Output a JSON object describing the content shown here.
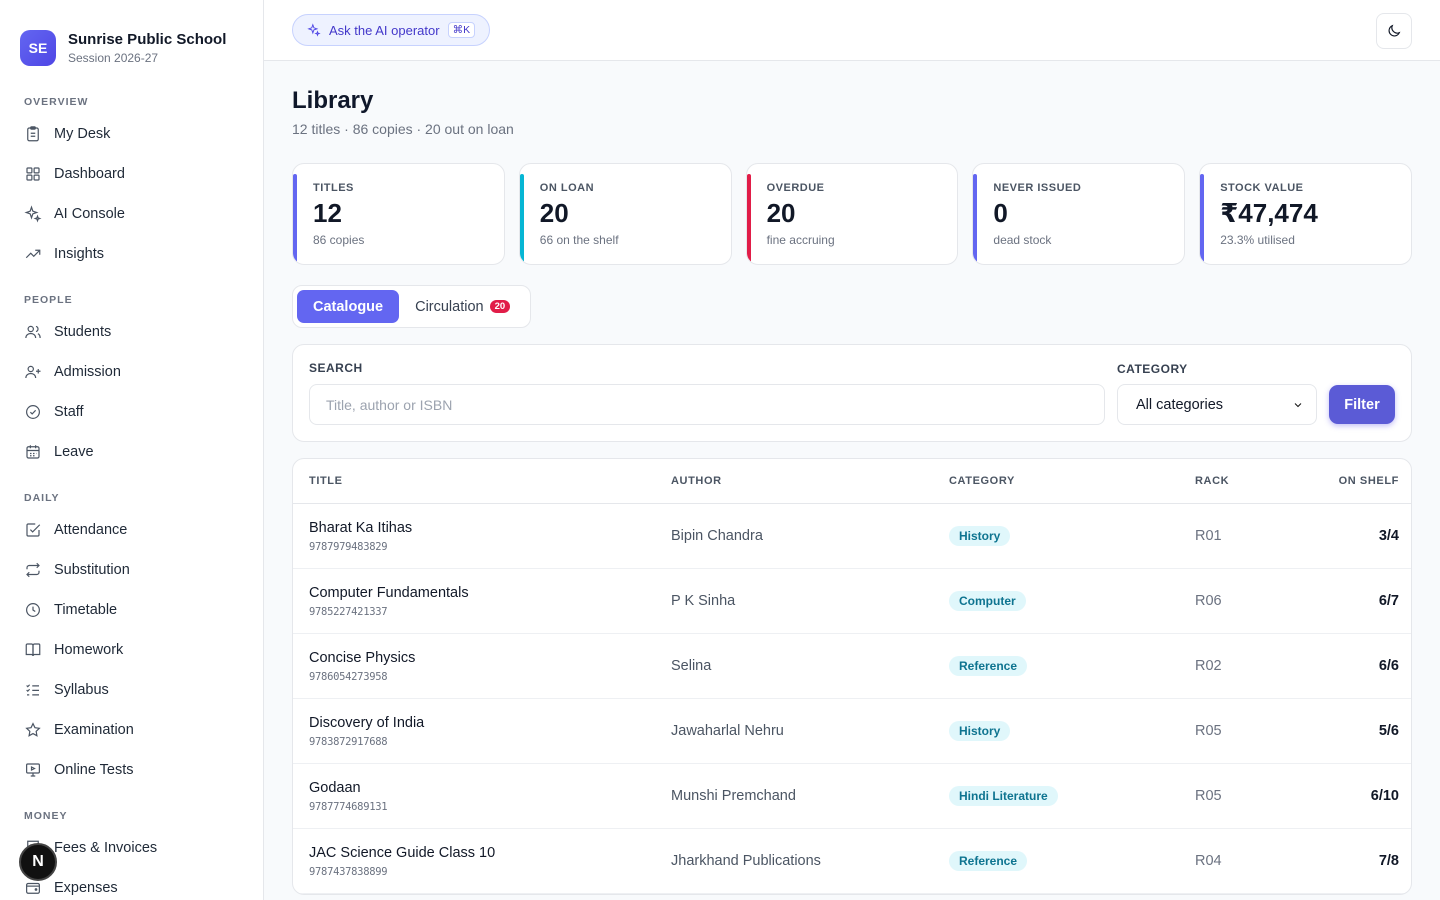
{
  "brand": {
    "logo": "SE",
    "name": "Sunrise Public School",
    "session": "Session 2026-27"
  },
  "sidebar": {
    "sections": [
      {
        "heading": "OVERVIEW",
        "items": [
          {
            "label": "My Desk",
            "icon": "clipboard-icon"
          },
          {
            "label": "Dashboard",
            "icon": "grid-icon"
          },
          {
            "label": "AI Console",
            "icon": "sparkle-icon"
          },
          {
            "label": "Insights",
            "icon": "trend-icon"
          }
        ]
      },
      {
        "heading": "PEOPLE",
        "items": [
          {
            "label": "Students",
            "icon": "users-icon"
          },
          {
            "label": "Admission",
            "icon": "user-plus-icon"
          },
          {
            "label": "Staff",
            "icon": "check-circle-icon"
          },
          {
            "label": "Leave",
            "icon": "calendar-icon"
          }
        ]
      },
      {
        "heading": "DAILY",
        "items": [
          {
            "label": "Attendance",
            "icon": "checkbox-icon"
          },
          {
            "label": "Substitution",
            "icon": "repeat-icon"
          },
          {
            "label": "Timetable",
            "icon": "clock-icon"
          },
          {
            "label": "Homework",
            "icon": "book-icon"
          },
          {
            "label": "Syllabus",
            "icon": "list-check-icon"
          },
          {
            "label": "Examination",
            "icon": "star-icon"
          },
          {
            "label": "Online Tests",
            "icon": "monitor-icon"
          }
        ]
      },
      {
        "heading": "MONEY",
        "items": [
          {
            "label": "Fees & Invoices",
            "icon": "receipt-icon"
          },
          {
            "label": "Expenses",
            "icon": "wallet-icon"
          }
        ]
      }
    ],
    "avatar": "N"
  },
  "topbar": {
    "ai_label": "Ask the AI operator",
    "shortcut": "⌘K"
  },
  "page": {
    "title": "Library",
    "subtitle": "12 titles · 86 copies · 20 out on loan"
  },
  "stats": [
    {
      "label": "TITLES",
      "value": "12",
      "note": "86 copies",
      "accent": "#6366f1"
    },
    {
      "label": "ON LOAN",
      "value": "20",
      "note": "66 on the shelf",
      "accent": "#06b6d4"
    },
    {
      "label": "OVERDUE",
      "value": "20",
      "note": "fine accruing",
      "accent": "#e11d48"
    },
    {
      "label": "NEVER ISSUED",
      "value": "0",
      "note": "dead stock",
      "accent": "#6366f1"
    },
    {
      "label": "STOCK VALUE",
      "value": "₹47,474",
      "note": "23.3% utilised",
      "accent": "#6366f1"
    }
  ],
  "tabs": {
    "catalogue": "Catalogue",
    "circulation": "Circulation",
    "circulation_count": "20"
  },
  "filter": {
    "search_label": "SEARCH",
    "search_placeholder": "Title, author or ISBN",
    "category_label": "CATEGORY",
    "category_value": "All categories",
    "button": "Filter"
  },
  "table": {
    "headers": {
      "title": "TITLE",
      "author": "AUTHOR",
      "category": "CATEGORY",
      "rack": "RACK",
      "shelf": "ON SHELF"
    },
    "rows": [
      {
        "title": "Bharat Ka Itihas",
        "isbn": "9787979483829",
        "author": "Bipin Chandra",
        "category": "History",
        "rack": "R01",
        "shelf": "3/4"
      },
      {
        "title": "Computer Fundamentals",
        "isbn": "9785227421337",
        "author": "P K Sinha",
        "category": "Computer",
        "rack": "R06",
        "shelf": "6/7"
      },
      {
        "title": "Concise Physics",
        "isbn": "9786054273958",
        "author": "Selina",
        "category": "Reference",
        "rack": "R02",
        "shelf": "6/6"
      },
      {
        "title": "Discovery of India",
        "isbn": "9783872917688",
        "author": "Jawaharlal Nehru",
        "category": "History",
        "rack": "R05",
        "shelf": "5/6"
      },
      {
        "title": "Godaan",
        "isbn": "9787774689131",
        "author": "Munshi Premchand",
        "category": "Hindi Literature",
        "rack": "R05",
        "shelf": "6/10"
      },
      {
        "title": "JAC Science Guide Class 10",
        "isbn": "9787437838899",
        "author": "Jharkhand Publications",
        "category": "Reference",
        "rack": "R04",
        "shelf": "7/8"
      }
    ]
  }
}
